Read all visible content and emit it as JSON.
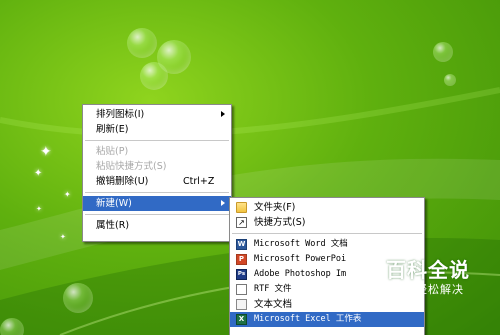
{
  "context_menu": {
    "items": [
      {
        "label": "排列图标",
        "accel": "(I)",
        "submenu": true
      },
      {
        "label": "刷新",
        "accel": "(E)"
      },
      {
        "label": "粘贴",
        "accel": "(P)",
        "disabled": true
      },
      {
        "label": "粘贴快捷方式",
        "accel": "(S)",
        "disabled": true
      },
      {
        "label": "撤销删除",
        "accel": "(U)",
        "shortcut": "Ctrl+Z"
      },
      {
        "label": "新建",
        "accel": "(W)",
        "submenu": true,
        "selected": true
      },
      {
        "label": "属性",
        "accel": "(R)"
      }
    ]
  },
  "new_submenu": {
    "items": [
      {
        "label": "文件夹",
        "accel": "(F)",
        "icon": "folder-icon"
      },
      {
        "label": "快捷方式",
        "accel": "(S)",
        "icon": "shortcut-icon"
      },
      {
        "label": "Microsoft Word 文档",
        "icon": "word-doc-icon",
        "icon_letter": "W"
      },
      {
        "label": "Microsoft PowerPoi",
        "icon": "powerpoint-icon",
        "icon_letter": "P"
      },
      {
        "label": "Adobe Photoshop Im",
        "icon": "photoshop-icon",
        "icon_letter": "Ps"
      },
      {
        "label": "RTF 文件",
        "icon": "rtf-file-icon"
      },
      {
        "label": "文本文档",
        "icon": "text-doc-icon"
      },
      {
        "label": "Microsoft Excel 工作表",
        "icon": "excel-icon",
        "icon_letter": "X",
        "selected": true
      }
    ]
  },
  "watermark": {
    "title": "百科全说",
    "subtitle": "助你轻松解决"
  },
  "colors": {
    "desktop": "#5fb00e",
    "menu_highlight": "#316ac5",
    "disabled_text": "#a8a8a8"
  }
}
